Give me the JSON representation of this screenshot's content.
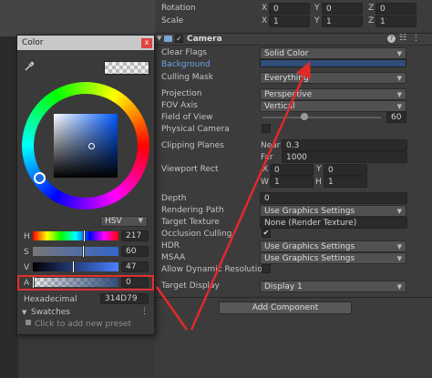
{
  "transform": {
    "rotation_label": "Rotation",
    "scale_label": "Scale",
    "rotation": {
      "x": "0",
      "y": "0",
      "z": "0"
    },
    "scale": {
      "x": "1",
      "y": "1",
      "z": "1"
    },
    "axis": {
      "x": "X",
      "y": "Y",
      "z": "Z"
    }
  },
  "camera": {
    "title": "Camera",
    "clear_flags": {
      "label": "Clear Flags",
      "value": "Solid Color"
    },
    "background": {
      "label": "Background",
      "color": "#314D79"
    },
    "culling_mask": {
      "label": "Culling Mask",
      "value": "Everything"
    },
    "projection": {
      "label": "Projection",
      "value": "Perspective"
    },
    "fov_axis": {
      "label": "FOV Axis",
      "value": "Vertical"
    },
    "field_of_view": {
      "label": "Field of View",
      "value": "60",
      "fraction": 0.35
    },
    "physical_camera": {
      "label": "Physical Camera"
    },
    "clipping_planes": {
      "label": "Clipping Planes",
      "near_label": "Near",
      "near": "0.3",
      "far_label": "Far",
      "far": "1000"
    },
    "viewport_rect": {
      "label": "Viewport Rect",
      "x_label": "X",
      "x": "0",
      "y_label": "Y",
      "y": "0",
      "w_label": "W",
      "w": "1",
      "h_label": "H",
      "h": "1"
    },
    "depth": {
      "label": "Depth",
      "value": "0"
    },
    "rendering_path": {
      "label": "Rendering Path",
      "value": "Use Graphics Settings"
    },
    "target_texture": {
      "label": "Target Texture",
      "value": "None (Render Texture)"
    },
    "occlusion_culling": {
      "label": "Occlusion Culling",
      "checked": "✔"
    },
    "hdr": {
      "label": "HDR",
      "value": "Use Graphics Settings"
    },
    "msaa": {
      "label": "MSAA",
      "value": "Use Graphics Settings"
    },
    "allow_dynamic_resolution": {
      "label": "Allow Dynamic Resolution"
    },
    "target_display": {
      "label": "Target Display",
      "value": "Display 1"
    }
  },
  "add_component": "Add Component",
  "color_picker": {
    "title": "Color",
    "close": "x",
    "mode": "HSV",
    "h": {
      "label": "H",
      "value": "217"
    },
    "s": {
      "label": "S",
      "value": "60"
    },
    "v": {
      "label": "V",
      "value": "47"
    },
    "a": {
      "label": "A",
      "value": "0"
    },
    "hex_label": "Hexadecimal",
    "hex_value": "314D79",
    "swatches_label": "Swatches",
    "add_preset": "Click to add new preset",
    "colors": {
      "base": "#314D79",
      "highlight": "#e03030"
    }
  }
}
